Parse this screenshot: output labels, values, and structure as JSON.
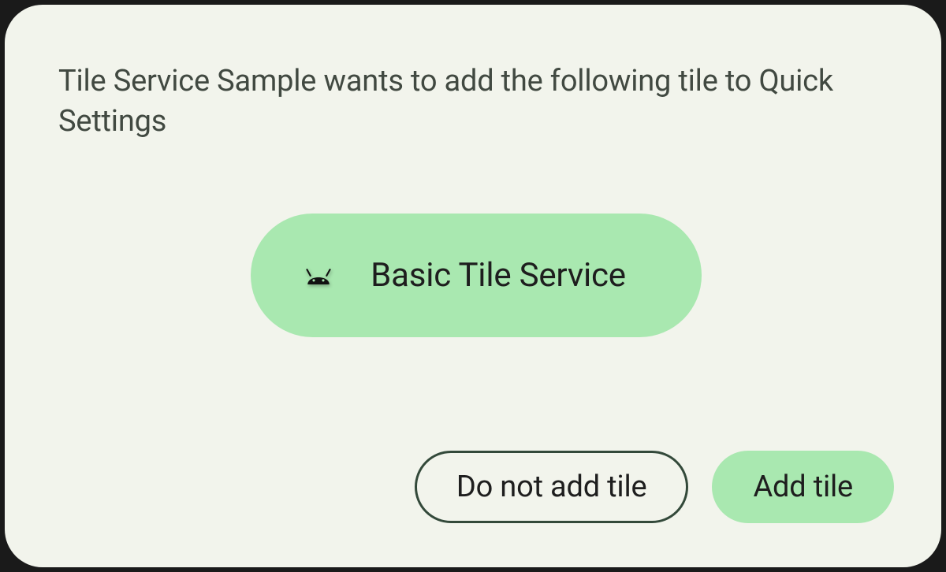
{
  "dialog": {
    "message": "Tile Service Sample wants to add the following tile to Quick Settings",
    "tile": {
      "icon_name": "android-icon",
      "label": "Basic Tile Service"
    },
    "actions": {
      "deny_label": "Do not add tile",
      "accept_label": "Add tile"
    }
  },
  "colors": {
    "surface": "#f2f4ec",
    "accent": "#a9e8b0",
    "outline": "#33493a",
    "text": "#414941"
  }
}
